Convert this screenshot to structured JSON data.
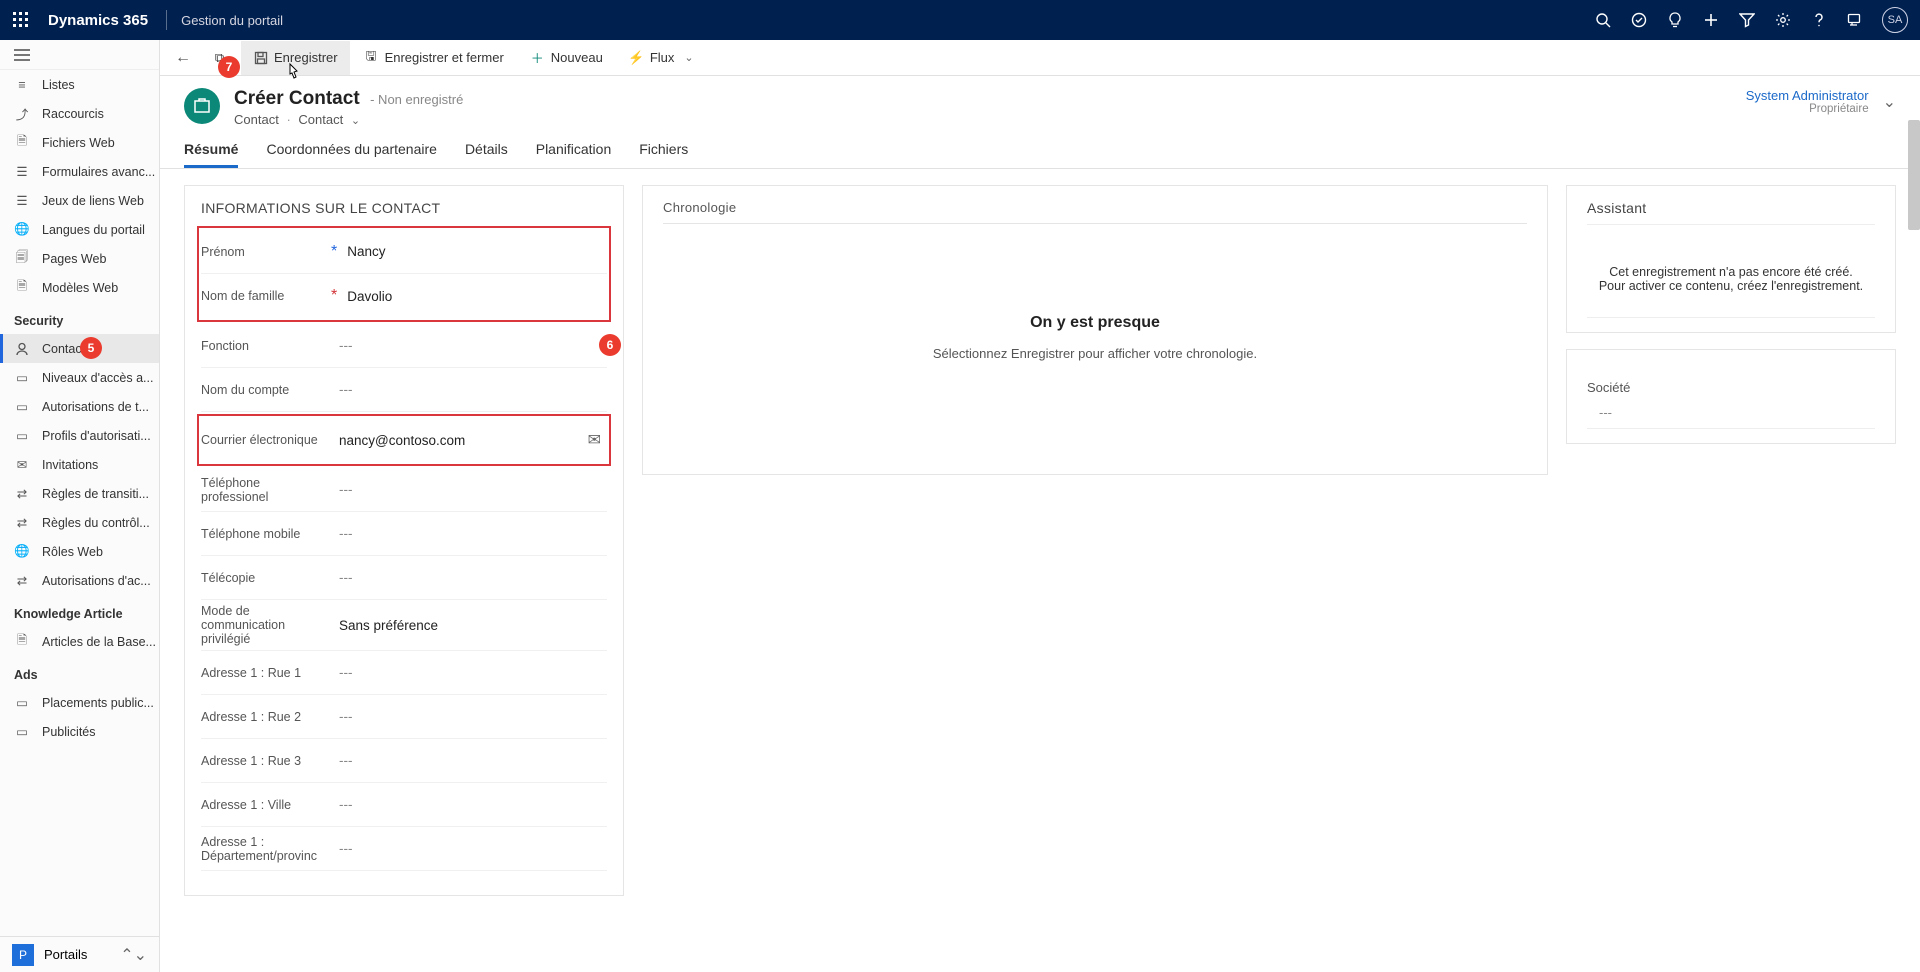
{
  "topbar": {
    "brand": "Dynamics 365",
    "subtitle": "Gestion du portail",
    "avatar": "SA"
  },
  "sidebar": {
    "items1": [
      {
        "label": "Listes"
      },
      {
        "label": "Raccourcis"
      },
      {
        "label": "Fichiers Web"
      },
      {
        "label": "Formulaires avanc..."
      },
      {
        "label": "Jeux de liens Web"
      },
      {
        "label": "Langues du portail"
      },
      {
        "label": "Pages Web"
      },
      {
        "label": "Modèles Web"
      }
    ],
    "section_security": "Security",
    "items2": [
      {
        "label": "Contacts",
        "active": true
      },
      {
        "label": "Niveaux d'accès a..."
      },
      {
        "label": "Autorisations de t..."
      },
      {
        "label": "Profils d'autorisati..."
      },
      {
        "label": "Invitations"
      },
      {
        "label": "Règles de transiti..."
      },
      {
        "label": "Règles du contrôl..."
      },
      {
        "label": "Rôles Web"
      },
      {
        "label": "Autorisations d'ac..."
      }
    ],
    "section_knowledge": "Knowledge Article",
    "items3": [
      {
        "label": "Articles de la Base..."
      }
    ],
    "section_ads": "Ads",
    "items4": [
      {
        "label": "Placements public..."
      },
      {
        "label": "Publicités"
      }
    ],
    "footer": {
      "letter": "P",
      "label": "Portails"
    }
  },
  "cmdbar": {
    "save": "Enregistrer",
    "save_close": "Enregistrer et fermer",
    "new": "Nouveau",
    "flow": "Flux"
  },
  "badges": {
    "b5": "5",
    "b6": "6",
    "b7": "7"
  },
  "header": {
    "title": "Créer Contact",
    "status": "- Non enregistré",
    "crumb1": "Contact",
    "crumb2": "Contact",
    "owner_name": "System Administrator",
    "owner_sub": "Propriétaire"
  },
  "tabs": [
    "Résumé",
    "Coordonnées du partenaire",
    "Détails",
    "Planification",
    "Fichiers"
  ],
  "info": {
    "section_title": "INFORMATIONS SUR LE CONTACT",
    "fields": {
      "firstname": {
        "label": "Prénom",
        "value": "Nancy",
        "req": "*",
        "reqClass": "req"
      },
      "lastname": {
        "label": "Nom de famille",
        "value": "Davolio",
        "req": "*",
        "reqClass": "req red"
      },
      "jobtitle": {
        "label": "Fonction",
        "value": "---",
        "empty": true
      },
      "account": {
        "label": "Nom du compte",
        "value": "---",
        "empty": true
      },
      "email": {
        "label": "Courrier électronique",
        "value": "nancy@contoso.com"
      },
      "phone1": {
        "label": "Téléphone professionel",
        "value": "---",
        "empty": true
      },
      "phone2": {
        "label": "Téléphone mobile",
        "value": "---",
        "empty": true
      },
      "fax": {
        "label": "Télécopie",
        "value": "---",
        "empty": true
      },
      "commpref": {
        "label": "Mode de communication privilégié",
        "value": "Sans préférence"
      },
      "addr1": {
        "label": "Adresse 1 : Rue 1",
        "value": "---",
        "empty": true
      },
      "addr2": {
        "label": "Adresse 1 : Rue 2",
        "value": "---",
        "empty": true
      },
      "addr3": {
        "label": "Adresse 1 : Rue 3",
        "value": "---",
        "empty": true
      },
      "city": {
        "label": "Adresse 1 : Ville",
        "value": "---",
        "empty": true
      },
      "region": {
        "label": "Adresse 1 : Département/provinc",
        "value": "---",
        "empty": true
      }
    }
  },
  "timeline": {
    "title": "Chronologie",
    "line1": "On y est presque",
    "line2": "Sélectionnez Enregistrer pour afficher votre chronologie."
  },
  "assistant": {
    "title": "Assistant",
    "note": "Cet enregistrement n'a pas encore été créé. Pour activer ce contenu, créez l'enregistrement.",
    "societe_label": "Société",
    "societe_value": "---"
  }
}
